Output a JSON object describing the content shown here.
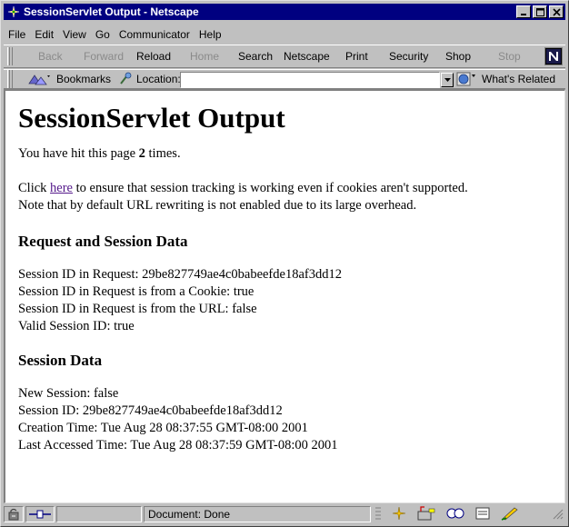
{
  "window": {
    "title": "SessionServlet Output - Netscape"
  },
  "menu": [
    {
      "label": "File",
      "name": "menu-file"
    },
    {
      "label": "Edit",
      "name": "menu-edit"
    },
    {
      "label": "View",
      "name": "menu-view"
    },
    {
      "label": "Go",
      "name": "menu-go"
    },
    {
      "label": "Communicator",
      "name": "menu-communicator"
    },
    {
      "label": "Help",
      "name": "menu-help"
    }
  ],
  "toolbar": {
    "back": "Back",
    "forward": "Forward",
    "reload": "Reload",
    "home": "Home",
    "search": "Search",
    "netscape": "Netscape",
    "print": "Print",
    "security": "Security",
    "shop": "Shop",
    "stop": "Stop"
  },
  "location": {
    "bookmarks": "Bookmarks",
    "label": "Location:",
    "value": "",
    "whats_related": "What's Related"
  },
  "page": {
    "heading": "SessionServlet Output",
    "hit_prefix": "You have hit this page ",
    "hit_count": "2",
    "hit_suffix": " times.",
    "click_prefix": "Click ",
    "link_text": "here",
    "click_suffix": " to ensure that session tracking is working even if cookies aren't supported.",
    "note": "Note that by default URL rewriting is not enabled due to its large overhead.",
    "section1_title": "Request and Session Data",
    "section1_lines": [
      "Session ID in Request: 29be827749ae4c0babeefde18af3dd12",
      "Session ID in Request is from a Cookie: true",
      "Session ID in Request is from the URL: false",
      "Valid Session ID: true"
    ],
    "section2_title": "Session Data",
    "section2_lines": [
      "New Session: false",
      "Session ID: 29be827749ae4c0babeefde18af3dd12",
      "Creation Time: Tue Aug 28 08:37:55 GMT-08:00 2001",
      "Last Accessed Time: Tue Aug 28 08:37:59 GMT-08:00 2001"
    ]
  },
  "status": {
    "text": "Document: Done"
  }
}
